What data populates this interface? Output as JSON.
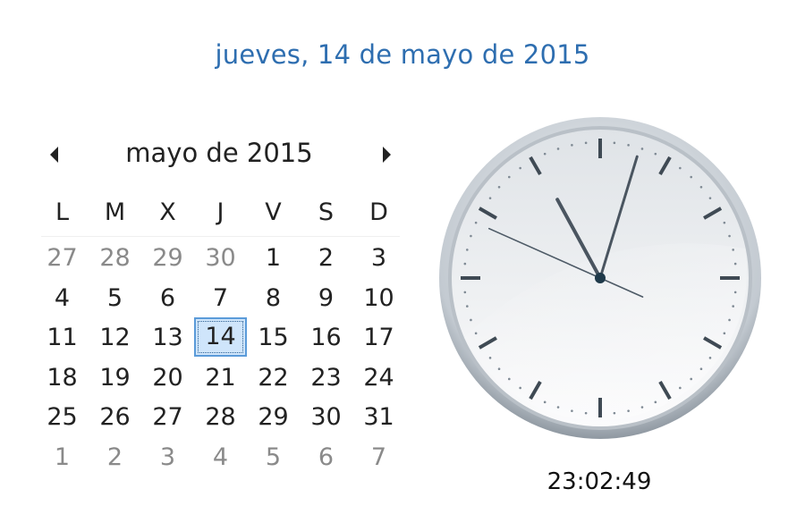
{
  "header": {
    "full_date": "jueves, 14 de mayo de 2015"
  },
  "calendar": {
    "month_title": "mayo de 2015",
    "prev_icon": "triangle-left-icon",
    "next_icon": "triangle-right-icon",
    "weekdays": [
      "L",
      "M",
      "X",
      "J",
      "V",
      "S",
      "D"
    ],
    "weeks": [
      [
        {
          "d": "27",
          "o": true
        },
        {
          "d": "28",
          "o": true
        },
        {
          "d": "29",
          "o": true
        },
        {
          "d": "30",
          "o": true
        },
        {
          "d": "1",
          "o": false
        },
        {
          "d": "2",
          "o": false
        },
        {
          "d": "3",
          "o": false
        }
      ],
      [
        {
          "d": "4",
          "o": false
        },
        {
          "d": "5",
          "o": false
        },
        {
          "d": "6",
          "o": false
        },
        {
          "d": "7",
          "o": false
        },
        {
          "d": "8",
          "o": false
        },
        {
          "d": "9",
          "o": false
        },
        {
          "d": "10",
          "o": false
        }
      ],
      [
        {
          "d": "11",
          "o": false
        },
        {
          "d": "12",
          "o": false
        },
        {
          "d": "13",
          "o": false
        },
        {
          "d": "14",
          "o": false,
          "today": true
        },
        {
          "d": "15",
          "o": false
        },
        {
          "d": "16",
          "o": false
        },
        {
          "d": "17",
          "o": false
        }
      ],
      [
        {
          "d": "18",
          "o": false
        },
        {
          "d": "19",
          "o": false
        },
        {
          "d": "20",
          "o": false
        },
        {
          "d": "21",
          "o": false
        },
        {
          "d": "22",
          "o": false
        },
        {
          "d": "23",
          "o": false
        },
        {
          "d": "24",
          "o": false
        }
      ],
      [
        {
          "d": "25",
          "o": false
        },
        {
          "d": "26",
          "o": false
        },
        {
          "d": "27",
          "o": false
        },
        {
          "d": "28",
          "o": false
        },
        {
          "d": "29",
          "o": false
        },
        {
          "d": "30",
          "o": false
        },
        {
          "d": "31",
          "o": false
        }
      ],
      [
        {
          "d": "1",
          "o": true
        },
        {
          "d": "2",
          "o": true
        },
        {
          "d": "3",
          "o": true
        },
        {
          "d": "4",
          "o": true
        },
        {
          "d": "5",
          "o": true
        },
        {
          "d": "6",
          "o": true
        },
        {
          "d": "7",
          "o": true
        }
      ]
    ],
    "today_highlight_color": "#cfe5fb",
    "today_border_color": "#5b9bd9"
  },
  "clock": {
    "hour": 23,
    "minute": 2,
    "second": 49,
    "time_text": "23:02:49",
    "face_color": "#e9ecef",
    "rim_color": "#9aa3ab",
    "hand_color": "#4a5560",
    "center_color": "#1f3a4a"
  }
}
